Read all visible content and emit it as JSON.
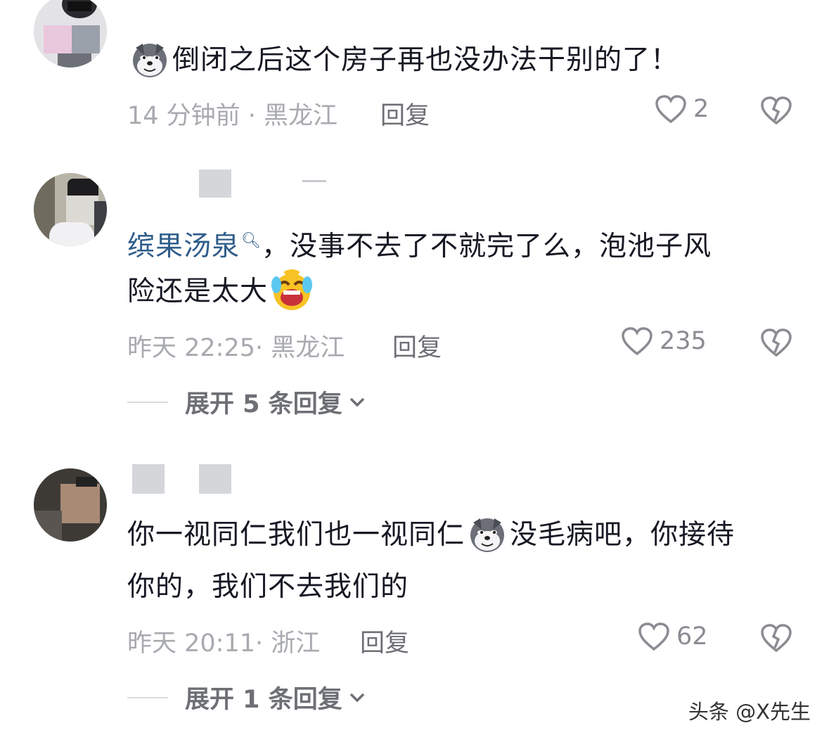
{
  "comments": [
    {
      "text": "倒闭之后这个房子再也没办法干别的了！",
      "meta": "14 分钟前 · 黑龙江",
      "reply_label": "回复",
      "likes": "2"
    },
    {
      "mention": "缤果汤泉",
      "text_line1": "，没事不去了不就完了么，泡池子风",
      "text_line2": "险还是太大",
      "meta": "昨天 22:25· 黑龙江",
      "reply_label": "回复",
      "likes": "235",
      "expand_label": "展开 5 条回复"
    },
    {
      "text_line1_a": "你一视同仁我们也一视同仁",
      "text_line1_b": "没毛病吧，你接待",
      "text_line2": "你的，我们不去我们的",
      "meta": "昨天 20:11· 浙江",
      "reply_label": "回复",
      "likes": "62",
      "expand_label": "展开 1 条回复"
    }
  ],
  "watermark": "头条 @X先生",
  "colors": {
    "mention": "#2f5d8a",
    "meta": "#a8aab0",
    "reply": "#6d6f75"
  },
  "icons": [
    "heart-icon",
    "broken-heart-icon",
    "wolf-emoji-icon",
    "crying-laugh-emoji-icon",
    "chevron-down-icon",
    "search-icon"
  ]
}
